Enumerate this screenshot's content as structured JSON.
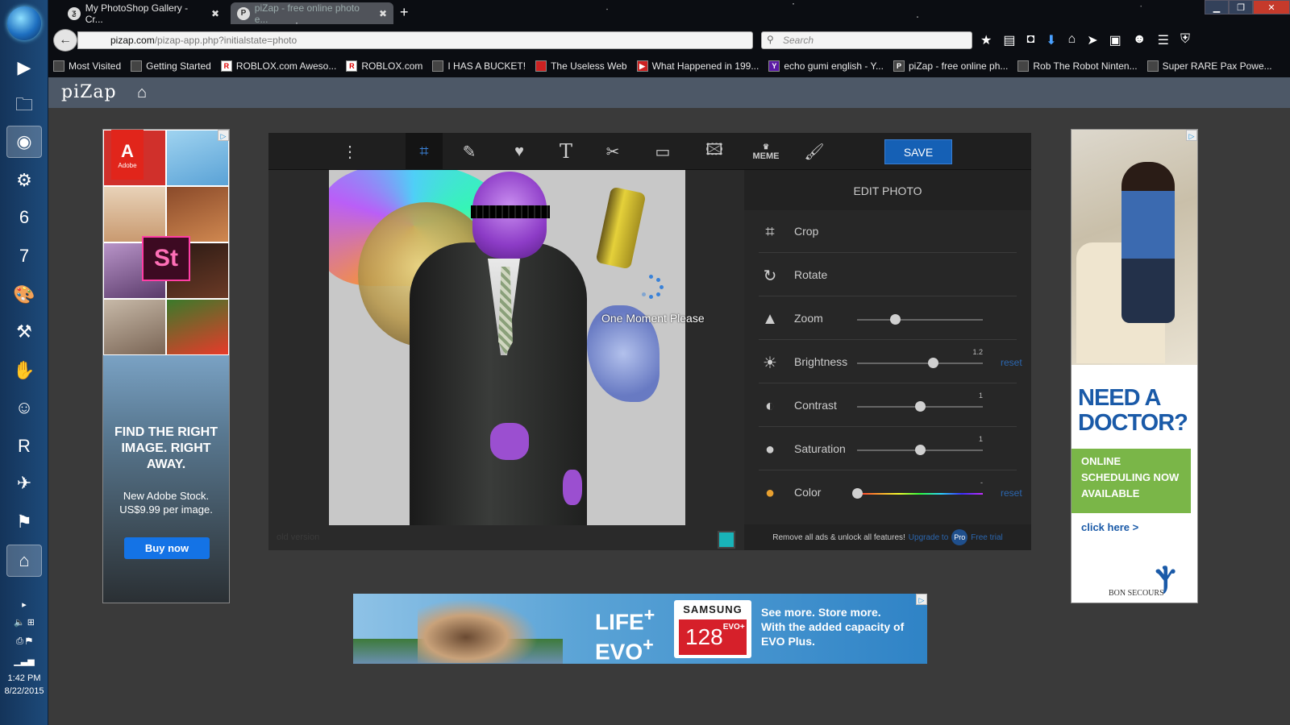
{
  "os": {
    "clock_time": "1:42 PM",
    "clock_date": "8/22/2015",
    "taskbar_icons": [
      "media-player-icon",
      "file-explorer-icon",
      "firefox-icon",
      "steam-icon",
      "game-6-icon",
      "game-7-icon",
      "paint-icon",
      "tools-icon",
      "hand-icon",
      "character-icon",
      "roblox-icon",
      "bird-icon",
      "app-icon",
      "hp-icon"
    ]
  },
  "browser": {
    "tabs": [
      {
        "label": "My PhotoShop Gallery - Cr..."
      },
      {
        "label": "piZap - free online photo e..."
      }
    ],
    "url_domain": "pizap.com",
    "url_path": "/pizap-app.php?initialstate=photo",
    "search_placeholder": "Search",
    "bookmarks": [
      {
        "label": "Most Visited"
      },
      {
        "label": "Getting Started"
      },
      {
        "label": "ROBLOX.com Aweso..."
      },
      {
        "label": "ROBLOX.com"
      },
      {
        "label": "I HAS A BUCKET!"
      },
      {
        "label": "The Useless Web"
      },
      {
        "label": "What Happened in 199..."
      },
      {
        "label": "echo gumi english - Y..."
      },
      {
        "label": "piZap - free online ph..."
      },
      {
        "label": "Rob The Robot Ninten..."
      },
      {
        "label": "Super RARE Pax Powe..."
      }
    ]
  },
  "site": {
    "logo": "piZap"
  },
  "editor": {
    "save_label": "SAVE",
    "panel_title": "EDIT PHOTO",
    "loading_text": "One Moment Please",
    "old_version": "old version",
    "tools": [
      "more-icon",
      "crop-icon",
      "magic-wand-icon",
      "heart-icon",
      "text-icon",
      "sticker-icon",
      "frame-icon",
      "background-icon",
      "meme-icon",
      "paint-brush-icon"
    ],
    "meme_label": "MEME",
    "swatch_color": "#19b3b8",
    "rows": [
      {
        "label": "Crop"
      },
      {
        "label": "Rotate"
      },
      {
        "label": "Zoom",
        "value": 0.3
      },
      {
        "label": "Brightness",
        "value": 0.6,
        "value_label": "1.2",
        "reset": "reset"
      },
      {
        "label": "Contrast",
        "value": 0.5,
        "value_label": "1"
      },
      {
        "label": "Saturation",
        "value": 0.5,
        "value_label": "1"
      },
      {
        "label": "Color",
        "value": 0.0,
        "value_label": "-",
        "reset": "reset"
      }
    ],
    "upgrade_text": "Remove all ads & unlock all features!",
    "upgrade_link": "Upgrade to",
    "pro_badge": "Pro",
    "free_trial": "Free trial"
  },
  "ads": {
    "left": {
      "brand": "Adobe",
      "product": "St",
      "headline": "FIND THE RIGHT IMAGE. RIGHT AWAY.",
      "subtext": "New Adobe Stock. US$9.99 per image.",
      "button": "Buy now"
    },
    "right": {
      "headline": "NEED A DOCTOR?",
      "green_text": "ONLINE SCHEDULING NOW AVAILABLE",
      "link": "click here >",
      "sponsor": "BON SECOURS"
    },
    "bottom": {
      "life": "LIFE",
      "evo": "EVO",
      "brand": "SAMSUNG",
      "capacity": "128",
      "card_label": "EVO+",
      "copy": "See more. Store more. With the added capacity of EVO Plus."
    }
  }
}
